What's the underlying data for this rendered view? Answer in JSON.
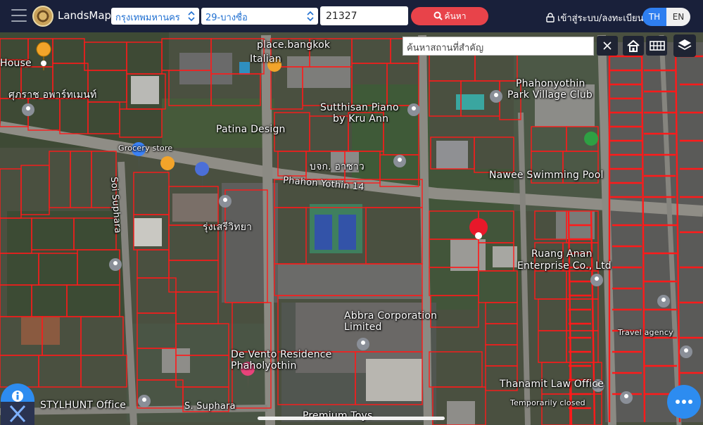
{
  "header": {
    "brand": "LandsMaps",
    "province": "กรุงเทพมหานคร",
    "district": "29-บางซื่อ",
    "parcel_value": "21327",
    "search_label": "ค้นหา",
    "login_label": "เข้าสู่ระบบ/ลงทะเบียน",
    "lang_th": "TH",
    "lang_en": "EN"
  },
  "map_tools": {
    "place_search_placeholder": "ค้นหาสถานที่สำคัญ"
  },
  "map_labels": [
    "place.bangkok",
    "House",
    "Italian",
    "Phahonyothin",
    "Park Village Club",
    "Sutthisan Piano",
    "by Kru Ann",
    "Patina Design",
    "Grocery store",
    "ศุภราช อพาร์ทเมนท์",
    "Nawee Swimming Pool",
    "Phahon Yothin 14",
    "Soi Suphara",
    "Ruang Anan",
    "Enterprise Co., Ltd",
    "Abbra Corporation",
    "Limited",
    "De Vento Residence",
    "Phaholyothin",
    "STYLHUNT Office",
    "S. Suphara",
    "Thanamit Law Office",
    "Temporarily closed",
    "Premium Toys",
    "Travel agency",
    "บจก. อาซาว",
    "รุ่งเสรีวิทยา"
  ],
  "colors": {
    "topbar": "#19203a",
    "search_button": "#e8434a",
    "parcel_line": "#ff1a1a",
    "accent": "#2d8cf0"
  }
}
